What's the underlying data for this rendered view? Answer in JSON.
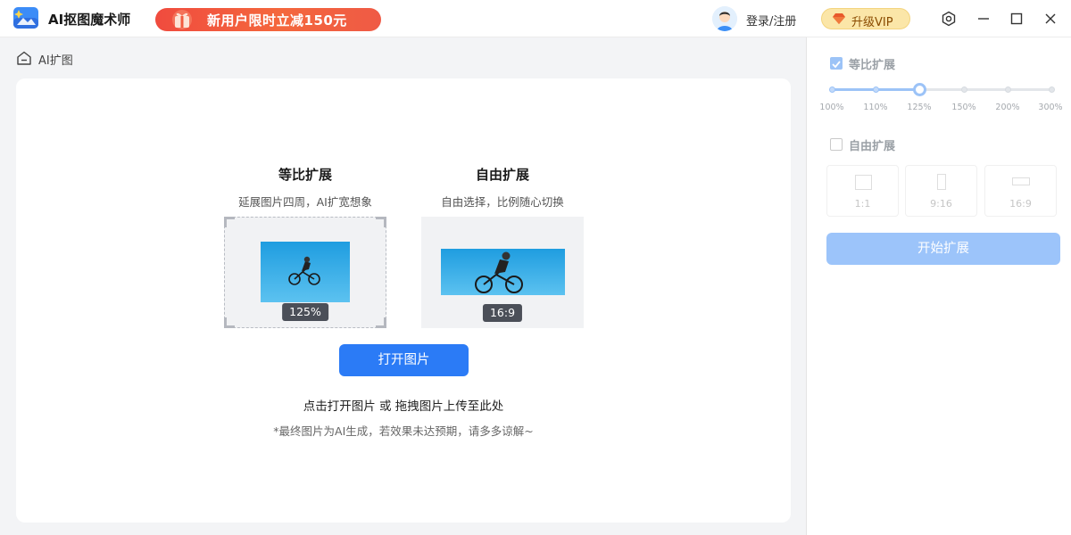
{
  "app": {
    "title": "AI抠图魔术师",
    "promo": "新用户限时立减150元",
    "login": "登录/注册",
    "vip": "升级VIP"
  },
  "breadcrumb": {
    "label": "AI扩图"
  },
  "main": {
    "modes": [
      {
        "title": "等比扩展",
        "desc": "延展图片四周，AI扩宽想象",
        "badge": "125%"
      },
      {
        "title": "自由扩展",
        "desc": "自由选择，比例随心切换",
        "badge": "16:9"
      }
    ],
    "open_button": "打开图片",
    "hint": "点击打开图片 或 拖拽图片上传至此处",
    "note": "*最终图片为AI生成，若效果未达预期，请多多谅解~"
  },
  "panel": {
    "proportional": {
      "label": "等比扩展",
      "checked": true,
      "ticks": [
        "100%",
        "110%",
        "125%",
        "150%",
        "200%",
        "300%"
      ],
      "selected_index": 2
    },
    "free": {
      "label": "自由扩展",
      "checked": false,
      "ratios": [
        "1:1",
        "9:16",
        "16:9"
      ]
    },
    "start_button": "开始扩展"
  },
  "colors": {
    "primary": "#2b7bf6",
    "disabled_primary": "#9cc4fa",
    "promo": "#f04b3e",
    "vip": "#fbe6a8"
  }
}
